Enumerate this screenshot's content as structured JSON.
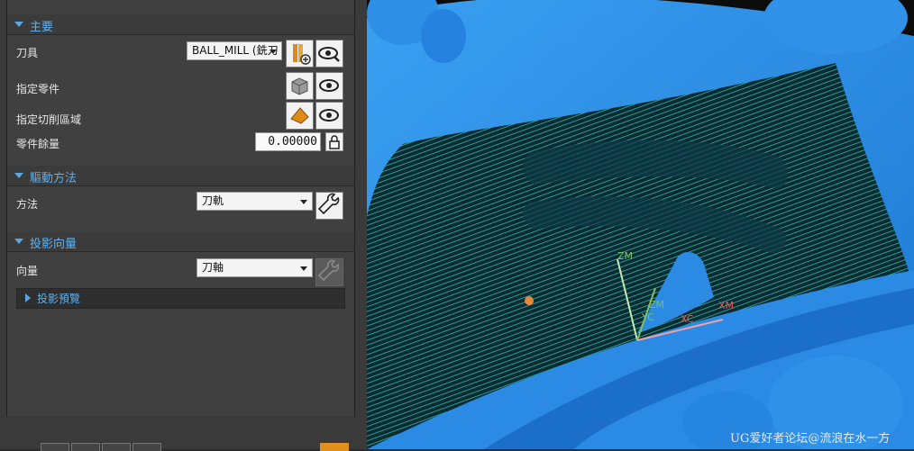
{
  "sections": {
    "main": {
      "title": "主要",
      "tool_label": "刀具",
      "tool_value": "BALL_MILL (銑刀",
      "part_label": "指定零件",
      "cut_area_label": "指定切削區域",
      "stock_label": "零件餘量",
      "stock_value": "0.00000"
    },
    "drive": {
      "title": "驅動方法",
      "method_label": "方法",
      "method_value": "刀軌"
    },
    "projection": {
      "title": "投影向量",
      "vector_label": "向量",
      "vector_value": "刀軸",
      "preview_label": "投影預覽"
    }
  },
  "viewport": {
    "axis_labels": {
      "zm": "ZM",
      "yc": "YC",
      "xc": "XC",
      "xm": "XM",
      "zc": "ZC",
      "top": "ZC"
    },
    "watermark": "UG爱好者论坛@流浪在水一方"
  },
  "colors": {
    "accent": "#5fb0ee",
    "part": "#2f8fe8",
    "toolpath": "#37d6c8",
    "background": "#0a0a0a"
  }
}
